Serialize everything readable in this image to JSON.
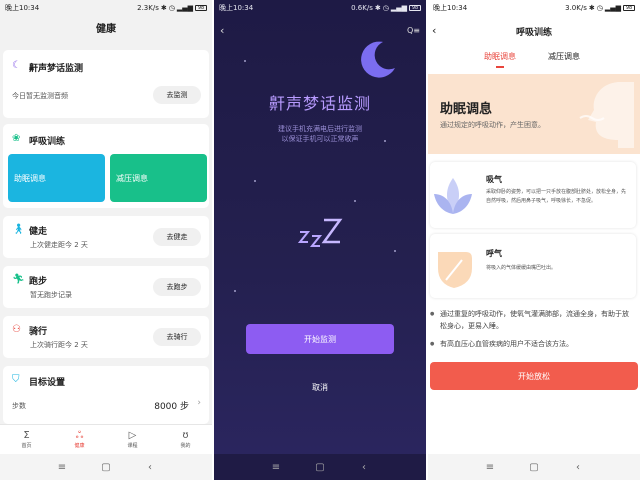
{
  "left": {
    "status": {
      "time": "晚上10:34",
      "speed": "2.3K/s",
      "battery": "98"
    },
    "title": "健康",
    "snore": {
      "title": "鼾声梦话监测",
      "sub": "今日暂无监测音频",
      "button": "去监测"
    },
    "breath": {
      "title": "呼吸训练",
      "tile1": "助眠调息",
      "tile2": "减压调息"
    },
    "walk": {
      "title": "健走",
      "sub": "上次健走距今 2 天",
      "button": "去健走"
    },
    "run": {
      "title": "跑步",
      "sub": "暂无跑步记录",
      "button": "去跑步"
    },
    "ride": {
      "title": "骑行",
      "sub": "上次骑行距今 2 天",
      "button": "去骑行"
    },
    "goal": {
      "title": "目标设置",
      "label": "步数",
      "value": "8000 步"
    },
    "tabs": [
      "首页",
      "健康",
      "课程",
      "我的"
    ],
    "colors": {
      "accent": "#e8453c",
      "tile1": "#1bb5e0",
      "tile2": "#18c08a"
    }
  },
  "middle": {
    "status": {
      "time": "晚上10:34",
      "speed": "0.6K/s",
      "battery": "98"
    },
    "title": "鼾声梦话监测",
    "desc1": "建议手机充满电后进行监测",
    "desc2": "以保证手机可以正常收声",
    "start": "开始监测",
    "cancel": "取消"
  },
  "right": {
    "status": {
      "time": "晚上10:34",
      "speed": "3.0K/s",
      "battery": "98"
    },
    "title": "呼吸训练",
    "tab1": "助眠调息",
    "tab2": "减压调息",
    "hero_title": "助眠调息",
    "hero_sub": "通过规定的呼吸动作，产生困意。",
    "inhale": {
      "title": "吸气",
      "body": "采取仰卧的姿势，可以把一只手放在腹部肚脐处，放松全身，先自然呼吸，然后用鼻子吸气，呼吸徐长，不急促。"
    },
    "exhale": {
      "title": "呼气",
      "body": "将吸入的气体缓缓由嘴巴吐出。"
    },
    "bullet1": "通过重复的呼吸动作，使氧气灌满肺部，流通全身，有助于放松身心，更易入睡。",
    "bullet2": "有高血压心血管疾病的用户不适合该方法。",
    "relax": "开始放松"
  }
}
